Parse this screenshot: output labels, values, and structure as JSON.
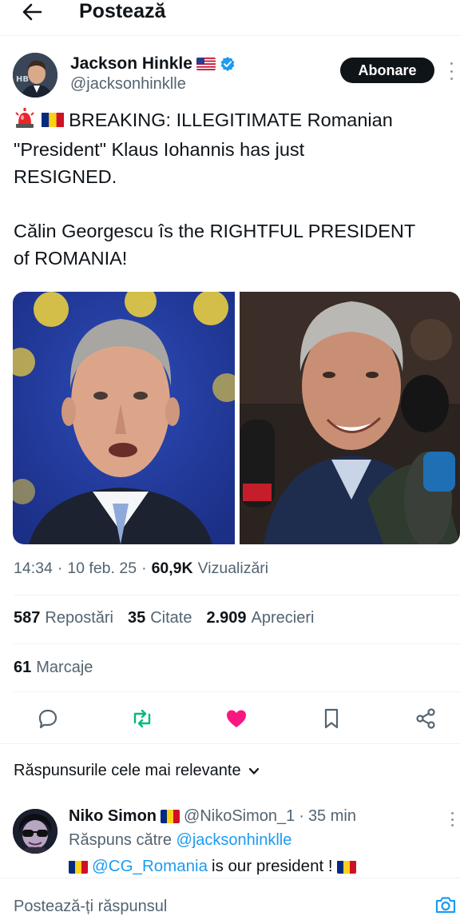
{
  "header": {
    "title": "Postează",
    "back_icon": "arrow-left-icon"
  },
  "author": {
    "name": "Jackson Hinkle",
    "name_flag": "🇺🇸",
    "handle": "@jacksonhinklle",
    "verified": true,
    "follow_label": "Abonare"
  },
  "tweet": {
    "lines": [
      "🚨🇷🇴 BREAKING: ILLEGITIMATE Romanian",
      "\"President\" Klaus Iohannis has just",
      "RESIGNED.",
      "Călin Georgescu îs the RIGHTFUL PRESIDENT",
      "of ROMANIA!"
    ],
    "line1_text": "BREAKING: ILLEGITIMATE Romanian",
    "line2": "\"President\" Klaus Iohannis has just",
    "line3": "RESIGNED.",
    "line4": "Călin Georgescu îs the RIGHTFUL PRESIDENT",
    "line5": "of ROMANIA!"
  },
  "meta": {
    "time": "14:34",
    "date": "10 feb. 25",
    "views_count": "60,9K",
    "views_label": "Vizualizări"
  },
  "stats": {
    "reposts_count": "587",
    "reposts_label": "Repostări",
    "quotes_count": "35",
    "quotes_label": "Citate",
    "likes_count": "2.909",
    "likes_label": "Aprecieri",
    "bookmarks_count": "61",
    "bookmarks_label": "Marcaje"
  },
  "actions": {
    "reply_icon": "reply-icon",
    "repost_icon": "repost-icon",
    "like_icon": "heart-icon",
    "bookmark_icon": "bookmark-icon",
    "share_icon": "share-icon",
    "repost_color": "#00ba7c",
    "like_color": "#f91880"
  },
  "replies_section": {
    "sort_label": "Răspunsurile cele mai relevante"
  },
  "reply": {
    "name": "Niko Simon",
    "handle": "@NikoSimon_1",
    "time": "35 min",
    "reply_to_prefix": "Răspuns către",
    "reply_to_handle": "@jacksonhinklle",
    "mention": "@CG_Romania",
    "text_suffix": "is our president !"
  },
  "compose": {
    "placeholder": "Postează-ți răspunsul"
  },
  "colors": {
    "accent": "#1d9bf0",
    "text_primary": "#0f1419",
    "text_secondary": "#536471"
  }
}
